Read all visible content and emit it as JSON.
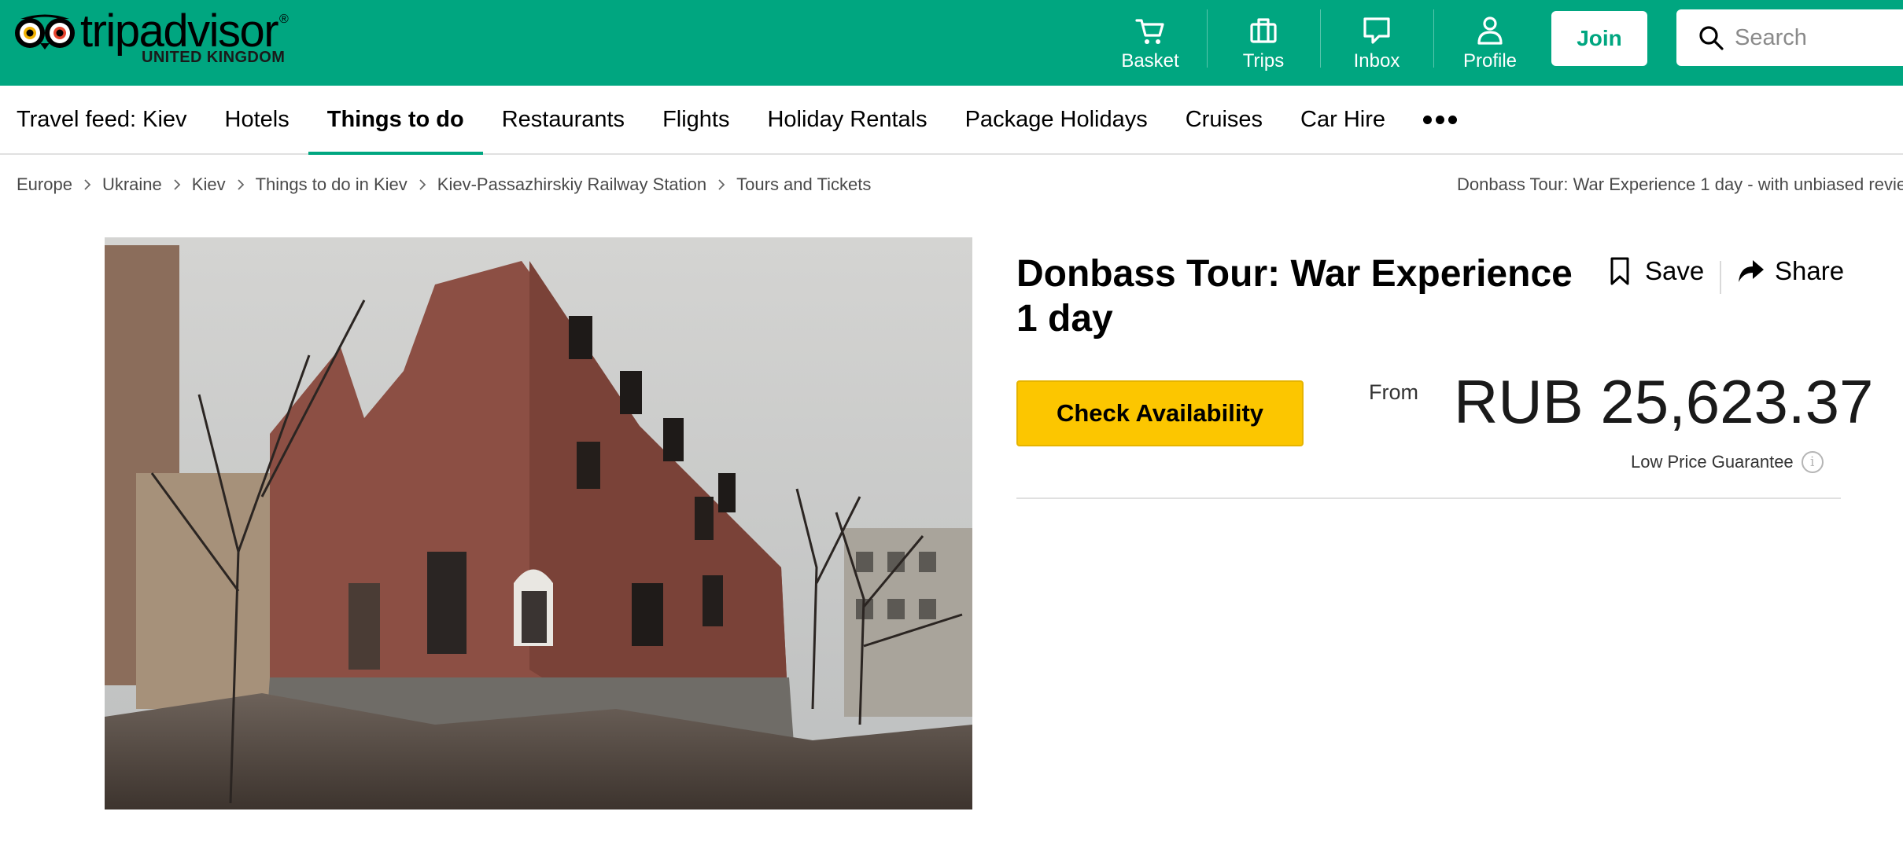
{
  "header": {
    "logo_text": "tripadvisor",
    "logo_sub": "UNITED KINGDOM",
    "nav": [
      {
        "label": "Basket",
        "icon": "basket-icon"
      },
      {
        "label": "Trips",
        "icon": "trips-icon"
      },
      {
        "label": "Inbox",
        "icon": "inbox-icon"
      },
      {
        "label": "Profile",
        "icon": "profile-icon"
      }
    ],
    "join_label": "Join",
    "search_placeholder": "Search",
    "brand_color": "#00a680"
  },
  "subnav": {
    "items": [
      "Travel feed: Kiev",
      "Hotels",
      "Things to do",
      "Restaurants",
      "Flights",
      "Holiday Rentals",
      "Package Holidays",
      "Cruises",
      "Car Hire"
    ],
    "active": "Things to do"
  },
  "breadcrumb": {
    "items": [
      "Europe",
      "Ukraine",
      "Kiev",
      "Things to do in Kiev",
      "Kiev-Passazhirskiy Railway Station",
      "Tours and Tickets"
    ],
    "right_text": "Donbass Tour: War Experience 1 day - with unbiased revie"
  },
  "listing": {
    "title": "Donbass Tour: War Experience 1 day",
    "save_label": "Save",
    "share_label": "Share",
    "check_label": "Check Availability",
    "from_label": "From",
    "price": "RUB 25,623.37",
    "price_note": "Low Price Guarantee",
    "info_glyph": "i",
    "check_color": "#fcc600"
  }
}
